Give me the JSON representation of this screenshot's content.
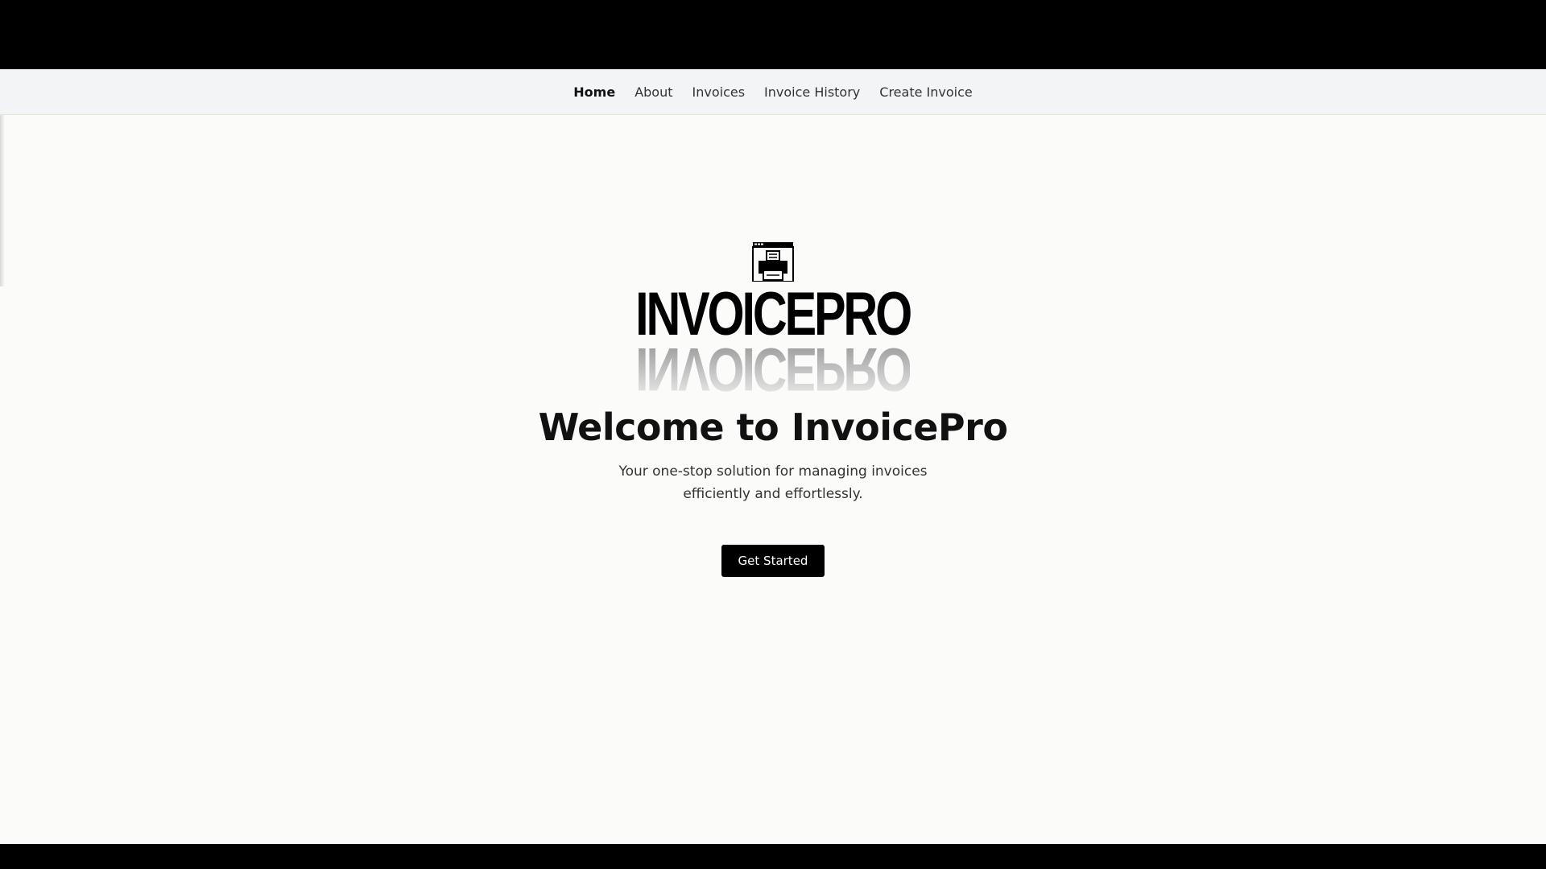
{
  "nav": {
    "items": [
      {
        "label": "Home",
        "active": true
      },
      {
        "label": "About",
        "active": false
      },
      {
        "label": "Invoices",
        "active": false
      },
      {
        "label": "Invoice History",
        "active": false
      },
      {
        "label": "Create Invoice",
        "active": false
      }
    ]
  },
  "hero": {
    "logo_text": "INVOICEPRO",
    "logo_icon": "printer-icon",
    "title": "Welcome to InvoicePro",
    "subtitle": "Your one-stop solution for managing invoices efficiently and effortlessly.",
    "cta_label": "Get Started"
  },
  "colors": {
    "background": "#fbfbfa",
    "navbar": "#f3f4f6",
    "button": "#000000",
    "text": "#111111"
  }
}
